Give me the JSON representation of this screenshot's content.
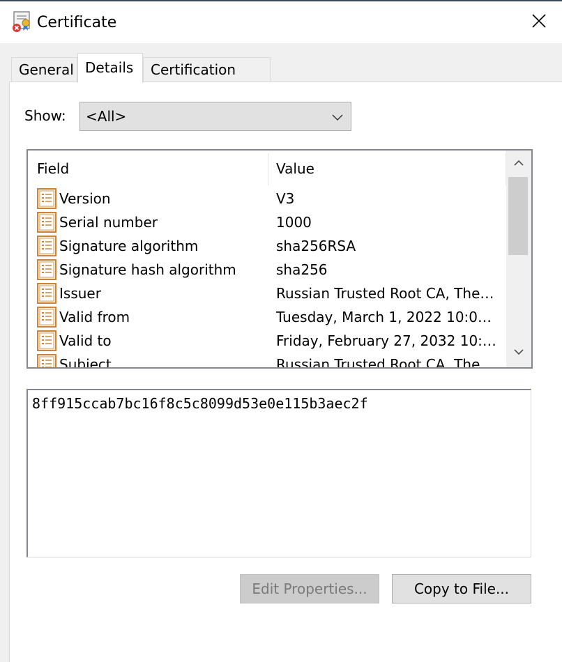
{
  "window": {
    "title": "Certificate",
    "title_icon": "certificate-error-icon",
    "close_icon": "close-icon"
  },
  "tabs": [
    {
      "label": "General",
      "selected": false
    },
    {
      "label": "Details",
      "selected": true
    },
    {
      "label": "Certification Path",
      "selected": false
    }
  ],
  "show": {
    "label": "Show:",
    "selected": "<All>"
  },
  "list": {
    "columns": [
      "Field",
      "Value"
    ],
    "rows": [
      {
        "field": "Version",
        "value": "V3"
      },
      {
        "field": "Serial number",
        "value": "1000"
      },
      {
        "field": "Signature algorithm",
        "value": "sha256RSA"
      },
      {
        "field": "Signature hash algorithm",
        "value": "sha256"
      },
      {
        "field": "Issuer",
        "value": "Russian Trusted Root CA, The…"
      },
      {
        "field": "Valid from",
        "value": "Tuesday, March 1, 2022 10:0…"
      },
      {
        "field": "Valid to",
        "value": "Friday, February 27, 2032 10:…"
      },
      {
        "field": "Subject",
        "value": "Russian Trusted Root CA, The…"
      }
    ],
    "row_icon": "field-list-icon"
  },
  "detail_value": "8ff915ccab7bc16f8c5c8099d53e0e115b3aec2f",
  "buttons": {
    "edit_properties": "Edit Properties...",
    "copy_to_file": "Copy to File..."
  },
  "colors": {
    "accent_border": "#828790",
    "button_face": "#e1e1e1",
    "disabled_text": "#7a7a7a",
    "icon_orange": "#c8843c"
  }
}
